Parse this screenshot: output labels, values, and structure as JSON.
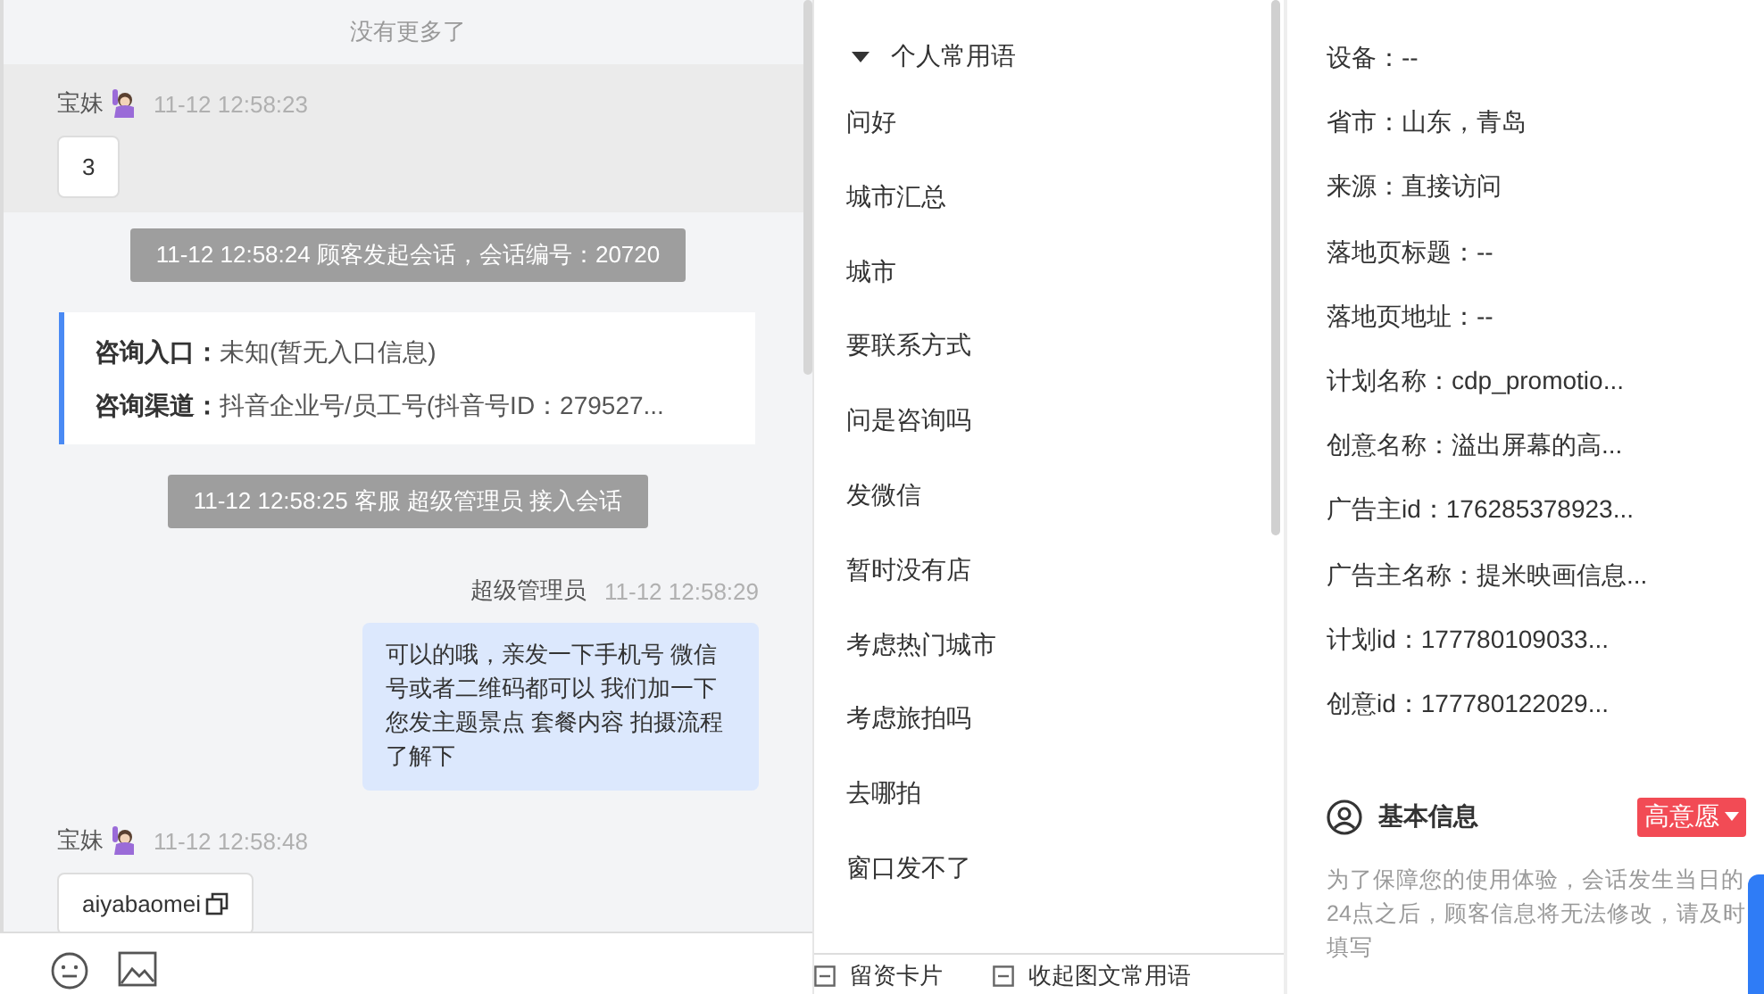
{
  "chat": {
    "no_more": "没有更多了",
    "messages": [
      {
        "kind": "customer",
        "highlighted": true,
        "sender": "宝妹",
        "time": "11-12 12:58:23",
        "text": "3",
        "copyable": false
      },
      {
        "kind": "system",
        "text": "11-12 12:58:24 顾客发起会话，会话编号：20720"
      },
      {
        "kind": "info",
        "rows": [
          {
            "label": "咨询入口：",
            "value": "未知(暂无入口信息)"
          },
          {
            "label": "咨询渠道：",
            "value": "抖音企业号/员工号(抖音号ID：279527..."
          }
        ]
      },
      {
        "kind": "system",
        "text": "11-12 12:58:25 客服 超级管理员 接入会话"
      },
      {
        "kind": "agent",
        "sender": "超级管理员",
        "time": "11-12 12:58:29",
        "text": "可以的哦，亲发一下手机号 微信号或者二维码都可以 我们加一下您发主题景点 套餐内容 拍摄流程了解下"
      },
      {
        "kind": "customer",
        "highlighted": false,
        "sender": "宝妹",
        "time": "11-12 12:58:48",
        "text": "aiyabaomei",
        "copyable": true
      }
    ]
  },
  "quick_replies": {
    "group": {
      "label": "个人常用语",
      "expanded": true
    },
    "items": [
      "问好",
      "城市汇总",
      "城市",
      "要联系方式",
      "问是咨询吗",
      "发微信",
      "暂时没有店",
      "考虑热门城市",
      "考虑旅拍吗",
      "去哪拍",
      "窗口发不了"
    ]
  },
  "toolbar": [
    "留资卡片",
    "收起图文常用语"
  ],
  "visitor_info": {
    "fields": [
      "设备：--",
      "省市：山东，青岛",
      "来源：直接访问",
      "落地页标题：--",
      "落地页地址：--",
      "计划名称：cdp_promotio...",
      "创意名称：溢出屏幕的高...",
      "广告主id：176285378923...",
      "广告主名称：提米映画信息...",
      "计划id：177780109033...",
      "创意id：177780122029..."
    ]
  },
  "basic_info": {
    "title": "基本信息",
    "intent_tag": "高意愿",
    "notice": "为了保障您的使用体验，会话发生当日的24点之后，顾客信息将无法修改，请及时填写"
  }
}
